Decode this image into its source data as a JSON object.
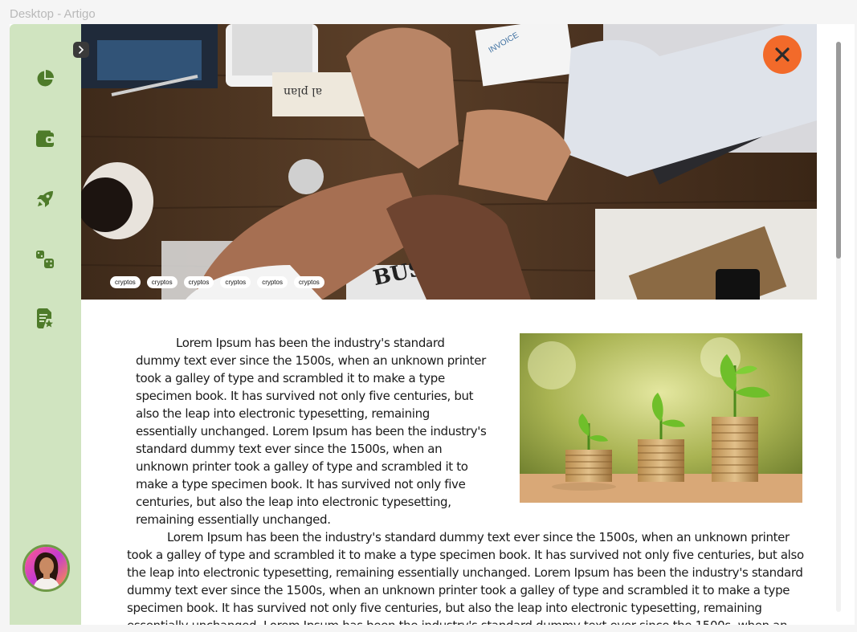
{
  "window": {
    "title": "Desktop - Artigo"
  },
  "sidebar": {
    "toggle_icon": "chevron-right-icon",
    "items": [
      {
        "name": "pie-chart-icon"
      },
      {
        "name": "wallet-icon"
      },
      {
        "name": "rocket-icon"
      },
      {
        "name": "dice-icon"
      },
      {
        "name": "document-star-icon"
      }
    ],
    "accent": "#4e7b2a",
    "background": "#d0e4c0"
  },
  "hero": {
    "close_icon": "close-icon",
    "close_color": "#f26a2a",
    "tags": [
      "cryptos",
      "cryptos",
      "cryptos",
      "cryptos",
      "cryptos",
      "cryptos"
    ]
  },
  "article": {
    "paragraph1": "Lorem Ipsum has been the industry's standard dummy text ever since the 1500s, when an unknown printer took a galley of type and scrambled it to make a type specimen book. It has survived not only five centuries, but also the leap into electronic typesetting, remaining essentially unchanged. Lorem Ipsum has been the industry's standard dummy text ever since the 1500s, when an unknown printer took a galley of type and scrambled it to make a type specimen book. It has survived not only five centuries, but also the leap into electronic typesetting, remaining essentially unchanged.",
    "paragraph2": "Lorem Ipsum has been the industry's standard dummy text ever since the 1500s, when an unknown printer took a galley of type and scrambled it to make a type specimen book. It has survived not only five centuries, but also the leap into electronic typesetting, remaining essentially unchanged. Lorem Ipsum has been the industry's standard dummy text ever since the 1500s, when an unknown printer took a galley of type and scrambled it to make a type specimen book. It has survived not only five centuries, but also the leap into electronic typesetting, remaining essentially unchanged. Lorem Ipsum has been the industry's standard dummy text ever since the 1500s, when an unknown printer took a galley of type and scrambled it to make a type specimen book."
  }
}
